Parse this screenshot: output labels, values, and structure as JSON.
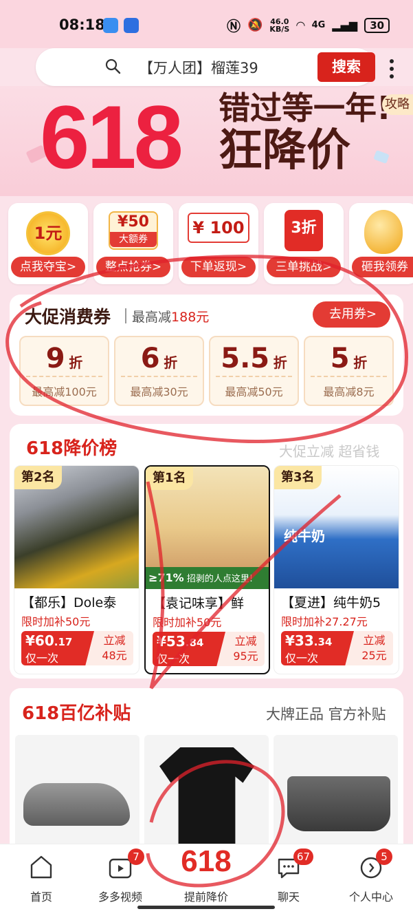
{
  "status_bar": {
    "time": "08:18",
    "network_speed": "46.0\nKB/S",
    "network_speed_top": "46.0",
    "network_speed_bottom": "KB/S",
    "signal": "4G",
    "battery": "30"
  },
  "search": {
    "query": "【万人团】榴莲39",
    "button": "搜索"
  },
  "banner": {
    "number": "618",
    "slogan_line1": "错过等一年!",
    "slogan_line2": "狂降价",
    "guide": "攻略"
  },
  "features": [
    {
      "icon_text": "1元",
      "label": "点我夺宝>"
    },
    {
      "icon_text": "¥50",
      "icon_sub": "大额券",
      "label": "整点抢券>"
    },
    {
      "icon_text": "¥ 100",
      "label": "下单返现>"
    },
    {
      "icon_text": "3折",
      "label": "三单挑战>"
    },
    {
      "label": "砸我领券"
    }
  ],
  "coupons": {
    "title": "大促消费券",
    "sub_prefix": "最高减",
    "sub_value": "188元",
    "use_button": "去用券>",
    "items": [
      {
        "value": "9",
        "unit": "折",
        "max": "最高减100元"
      },
      {
        "value": "6",
        "unit": "折",
        "max": "最高减30元"
      },
      {
        "value": "5.5",
        "unit": "折",
        "max": "最高减50元"
      },
      {
        "value": "5",
        "unit": "折",
        "max": "最高减8元"
      }
    ]
  },
  "rank": {
    "title": "618降价榜",
    "slogan": "大促立减 超省钱",
    "products": [
      {
        "badge": "第2名",
        "name": "【都乐】Dole泰",
        "subsidy": "限时加补50元",
        "price_int": "¥60",
        "price_dec": ".17",
        "once": "仅一次",
        "save_label": "立减",
        "save_value": "48元"
      },
      {
        "badge": "第1名",
        "name": "【袁记味享】鲜",
        "subsidy": "限时加补50元",
        "price_int": "¥53",
        "price_dec": ".84",
        "once": "仅一次",
        "save_label": "立减",
        "save_value": "95元"
      },
      {
        "badge": "第3名",
        "name": "【夏进】纯牛奶5",
        "subsidy": "限时加补27.27元",
        "price_int": "¥33",
        "price_dec": ".34",
        "once": "仅一次",
        "save_label": "立减",
        "save_value": "25元"
      }
    ],
    "img_text_2": "≥71%",
    "img_text_2b": "招剥的人点这里!",
    "img_text_3": "纯牛奶"
  },
  "subsidy": {
    "title": "618百亿补贴",
    "slogan": "大牌正品 官方补贴"
  },
  "tabbar": {
    "tabs": [
      {
        "label": "首页"
      },
      {
        "label": "多多视频",
        "badge": "7"
      },
      {
        "label": "提前降价",
        "big": "618"
      },
      {
        "label": "聊天",
        "badge": "67"
      },
      {
        "label": "个人中心",
        "badge": "5"
      }
    ]
  },
  "colors": {
    "accent": "#d8231c",
    "banner_red": "#ec2140",
    "page_bg": "#fbe3ea"
  }
}
